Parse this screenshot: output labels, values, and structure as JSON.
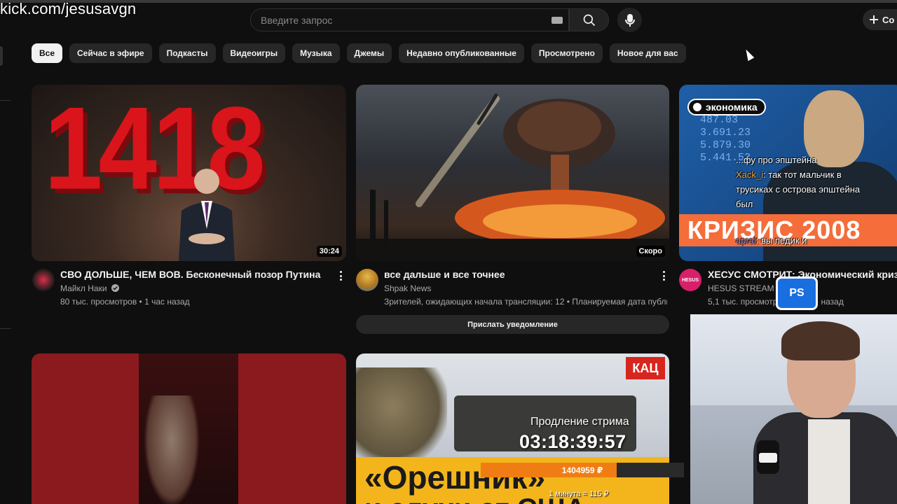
{
  "overlay": {
    "watermark": "kick.com/jesusavgn"
  },
  "header": {
    "search_placeholder": "Введите запрос",
    "create_label": "Со",
    "icons": [
      "keyboard-icon",
      "search-icon",
      "mic-icon",
      "plus-icon"
    ]
  },
  "chips": [
    {
      "label": "Все",
      "active": true
    },
    {
      "label": "Сейчас в эфире",
      "active": false
    },
    {
      "label": "Подкасты",
      "active": false
    },
    {
      "label": "Видеоигры",
      "active": false
    },
    {
      "label": "Музыка",
      "active": false
    },
    {
      "label": "Джемы",
      "active": false
    },
    {
      "label": "Недавно опубликованные",
      "active": false
    },
    {
      "label": "Просмотрено",
      "active": false
    },
    {
      "label": "Новое для вас",
      "active": false
    }
  ],
  "videos": [
    {
      "thumb_text": "1418",
      "duration": "30:24",
      "title": "СВО ДОЛЬШЕ, ЧЕМ ВОВ. Бесконечный позор Путина",
      "channel": "Майкл Наки",
      "verified": true,
      "meta": "80 тыс. просмотров • 1 час назад"
    },
    {
      "duration": "Скоро",
      "title": "все дальше и все точнее",
      "channel": "Shpak News",
      "meta": "Зрителей, ожидающих начала трансляции: 12 • Планируемая дата публикации",
      "notify_label": "Прислать уведомление"
    },
    {
      "thumb_badge": "экономика",
      "thumb_numbers": [
        "487.03",
        "3.691.23",
        "5.879.30",
        "5.441.52"
      ],
      "thumb_banner": "КРИЗИС 2008",
      "title": "ХЕСУС СМОТРИТ: Экономический кризис",
      "channel": "HESUS STREAM",
      "avatar_text": "HESUS",
      "meta_prefix": "5,1 тыс. просмотр",
      "meta_suffix": "назад"
    },
    {
      "title": ""
    },
    {
      "thumb_badge": "КАЦ",
      "thumb_line1": "«Орешник»",
      "thumb_line2": "и слухи от США"
    }
  ],
  "chat": [
    {
      "user": "",
      "text": "...фу про эпштейна"
    },
    {
      "user": "Xack_i",
      "text": ": так тот мальчик в"
    },
    {
      "user": "",
      "text": "трусиках с острова эпштейна"
    },
    {
      "user": "",
      "text": "был"
    },
    {
      "user": "apral",
      "text": ": вы педик и"
    }
  ],
  "stream_overlay": {
    "extend_label": "Продление стрима",
    "timer": "03:18:39:57",
    "amount": "1404959 ₽",
    "progress_fraction": 0.67,
    "rate": "1 минута = 115 ₽",
    "ps_badge": "PS"
  },
  "colors": {
    "background": "#0f0f0f",
    "chip": "#272727",
    "chip_active": "#f1f1f1",
    "progress": "#f07d13",
    "secondary_text": "#aaaaaa"
  }
}
